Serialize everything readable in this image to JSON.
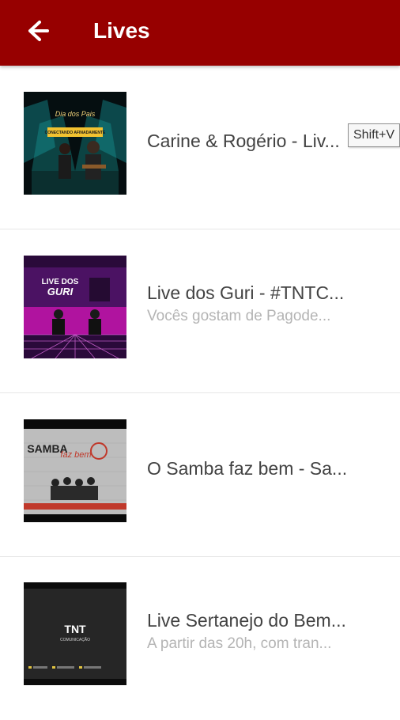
{
  "header": {
    "title": "Lives",
    "back_icon": "arrow-left-icon",
    "background_color": "#970000"
  },
  "items": [
    {
      "title": "Carine & Rogério - Liv...",
      "subtitle": "",
      "thumb_lines": [
        "Dia dos Pais",
        "CONECTANDO AFINADAMENTE"
      ]
    },
    {
      "title": "Live dos Guri - #TNTC...",
      "subtitle": "Vocês gostam de Pagode...",
      "thumb_lines": [
        "LIVE DOS",
        "GURI"
      ]
    },
    {
      "title": "O Samba faz bem - Sa...",
      "subtitle": "",
      "thumb_lines": [
        "SAMBA",
        "faz bem"
      ]
    },
    {
      "title": "Live Sertanejo do Bem...",
      "subtitle": "A partir das 20h, com tran...",
      "thumb_lines": [
        "TNT",
        "COMUNICAÇÃO"
      ]
    }
  ],
  "tooltip": {
    "text": "Shift+V"
  }
}
